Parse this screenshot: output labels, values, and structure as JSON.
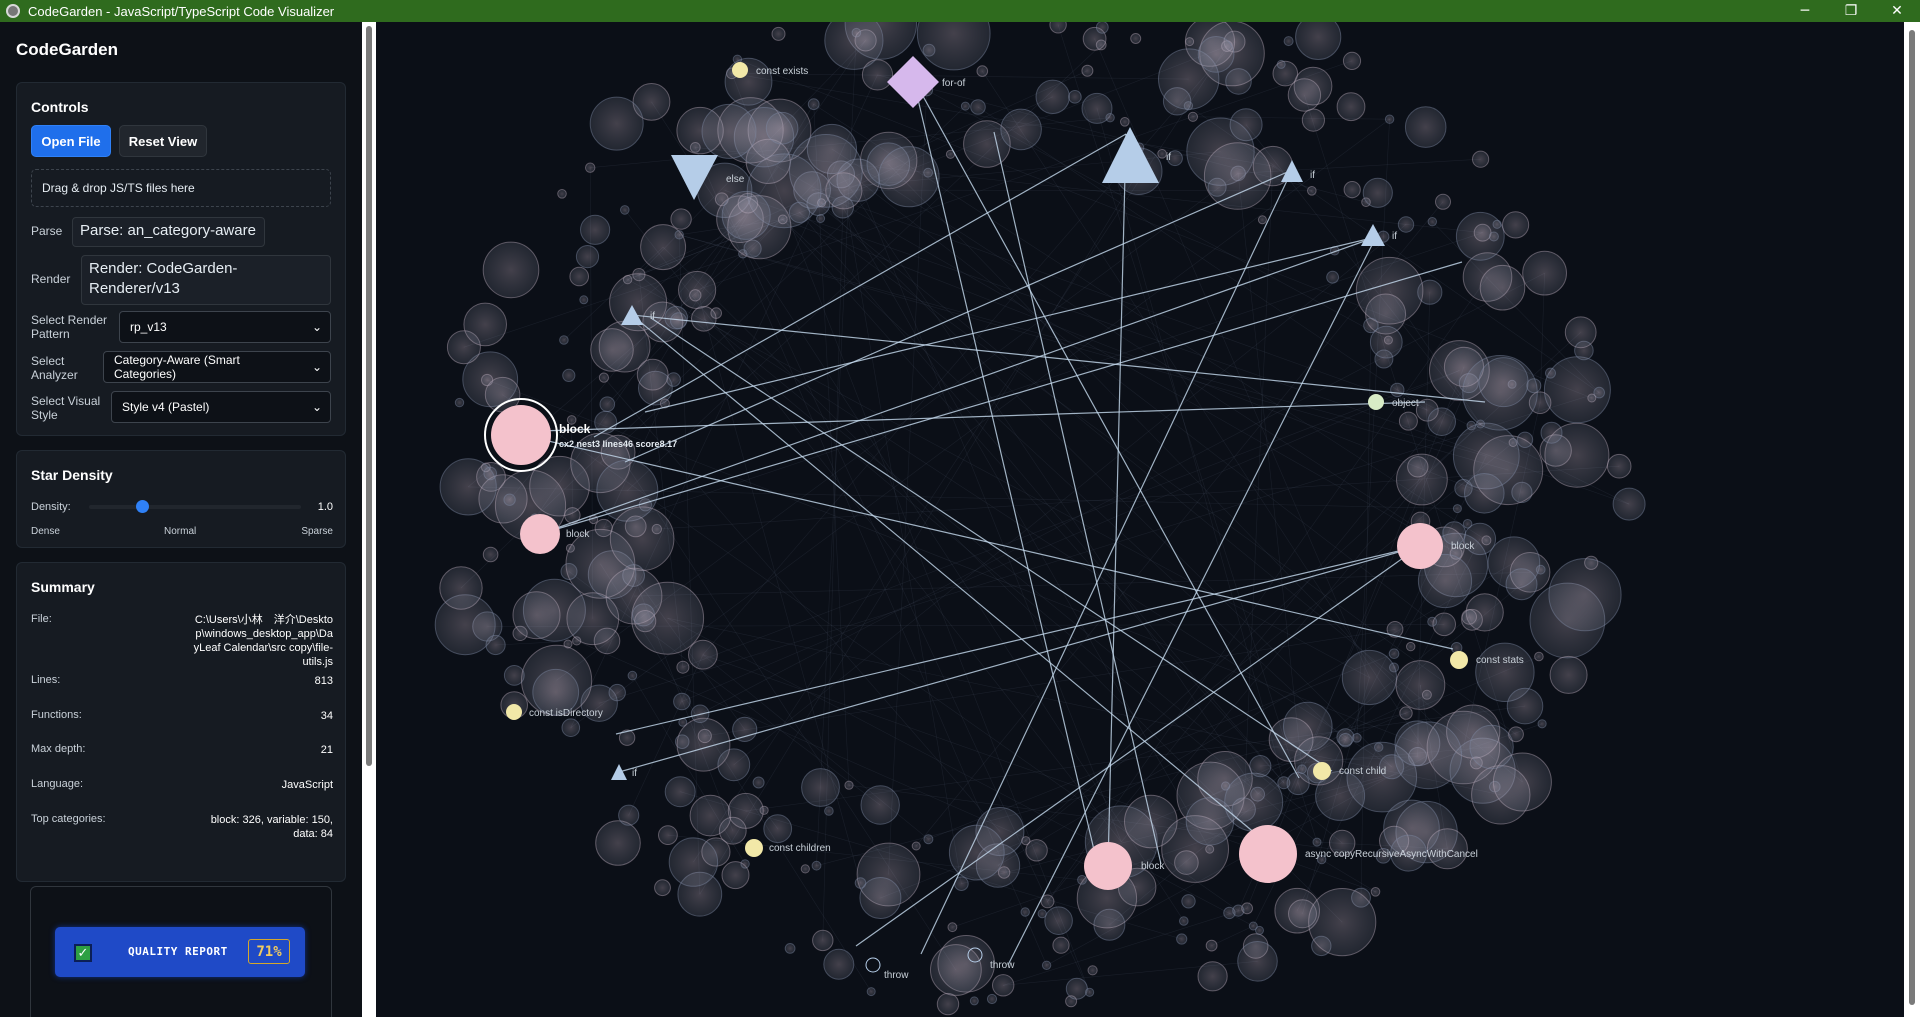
{
  "window": {
    "title": "CodeGarden - JavaScript/TypeScript Code Visualizer",
    "minimize": "─",
    "restore": "❐",
    "close": "✕"
  },
  "sidebar": {
    "app_name": "CodeGarden",
    "controls": {
      "heading": "Controls",
      "open_file": "Open File",
      "reset_view": "Reset View",
      "dropzone": "Drag & drop JS/TS files here",
      "parse_label": "Parse",
      "parse_value": "Parse: an_category-aware",
      "render_label": "Render",
      "render_value": "Render: CodeGarden-Renderer/v13",
      "pattern_label": "Select Render Pattern",
      "pattern_value": "rp_v13",
      "analyzer_label": "Select Analyzer",
      "analyzer_value": "Category-Aware (Smart Categories)",
      "style_label": "Select Visual Style",
      "style_value": "Style v4 (Pastel)"
    },
    "density": {
      "heading": "Star Density",
      "label": "Density:",
      "value": "1.0",
      "fraction": 0.25,
      "dense": "Dense",
      "normal": "Normal",
      "sparse": "Sparse"
    },
    "summary": {
      "heading": "Summary",
      "file_label": "File:",
      "file_value": "C:\\Users\\小林　洋介\\Desktop\\windows_desktop_app\\DayLeaf Calendar\\src copy\\file-utils.js",
      "lines_label": "Lines:",
      "lines_value": "813",
      "functions_label": "Functions:",
      "functions_value": "34",
      "depth_label": "Max depth:",
      "depth_value": "21",
      "language_label": "Language:",
      "language_value": "JavaScript",
      "categories_label": "Top categories:",
      "categories_value": "block: 326, variable: 150, data: 84"
    },
    "quality": {
      "label": "QUALITY REPORT",
      "percent": "71%"
    }
  },
  "graph": {
    "colors": {
      "background": "#0b0f17",
      "edge": "#c7dcf0",
      "block": "#f4c2cc",
      "variable": "#f2e8a8",
      "control": "#b5cde8",
      "loop": "#d6b8ec"
    },
    "labels": {
      "const_exists": "const exists",
      "for_of": "for-of",
      "else": "else",
      "if": "if",
      "block": "block",
      "block_stats": "cx2 nest3 lines46 score8.17",
      "object": "object",
      "const_stats": "const stats",
      "const_isdirectory": "const isDirectory",
      "const_child": "const child",
      "const_children": "const children",
      "async_copy": "async copyRecursiveAsyncWithCancel",
      "throw": "throw"
    }
  }
}
